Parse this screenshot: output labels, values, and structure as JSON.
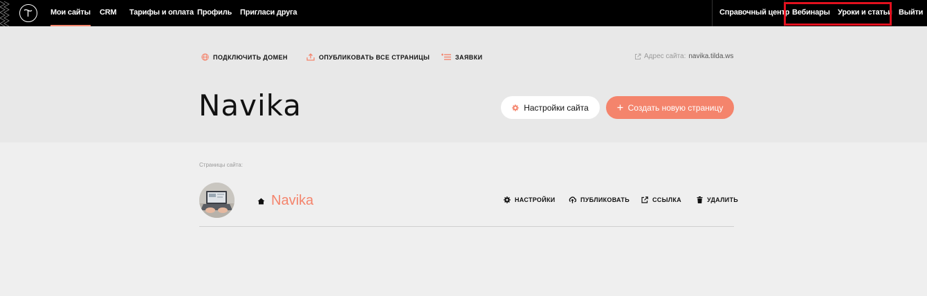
{
  "topnav": {
    "items": [
      {
        "label": "Мои сайты",
        "active": true
      },
      {
        "label": "CRM"
      },
      {
        "label": "Тарифы и оплата"
      },
      {
        "label": "Профиль"
      },
      {
        "label": "Пригласи друга"
      }
    ],
    "right": {
      "help": "Справочный центр",
      "webinars": "Вебинары",
      "lessons": "Уроки и статьи",
      "logout": "Выйти"
    }
  },
  "header": {
    "actions": {
      "connect_domain": "Подключить домен",
      "publish_all": "Опубликовать все страницы",
      "requests": "Заявки"
    },
    "address_label": "Адрес сайта:",
    "address_value": "navika.tilda.ws",
    "site_title": "Navika",
    "settings_button": "Настройки сайта",
    "create_button": "Создать новую страницу"
  },
  "pages": {
    "label": "Страницы сайта:",
    "items": [
      {
        "name": "Navika",
        "actions": {
          "settings": "Настройки",
          "publish": "Публиковать",
          "link": "Ссылка",
          "delete": "Удалить"
        }
      }
    ]
  },
  "colors": {
    "accent": "#f4846c",
    "nav_bg": "#000000",
    "header_bg": "#e8e8e8",
    "body_bg": "#efefef",
    "highlight": "#e3101e"
  }
}
